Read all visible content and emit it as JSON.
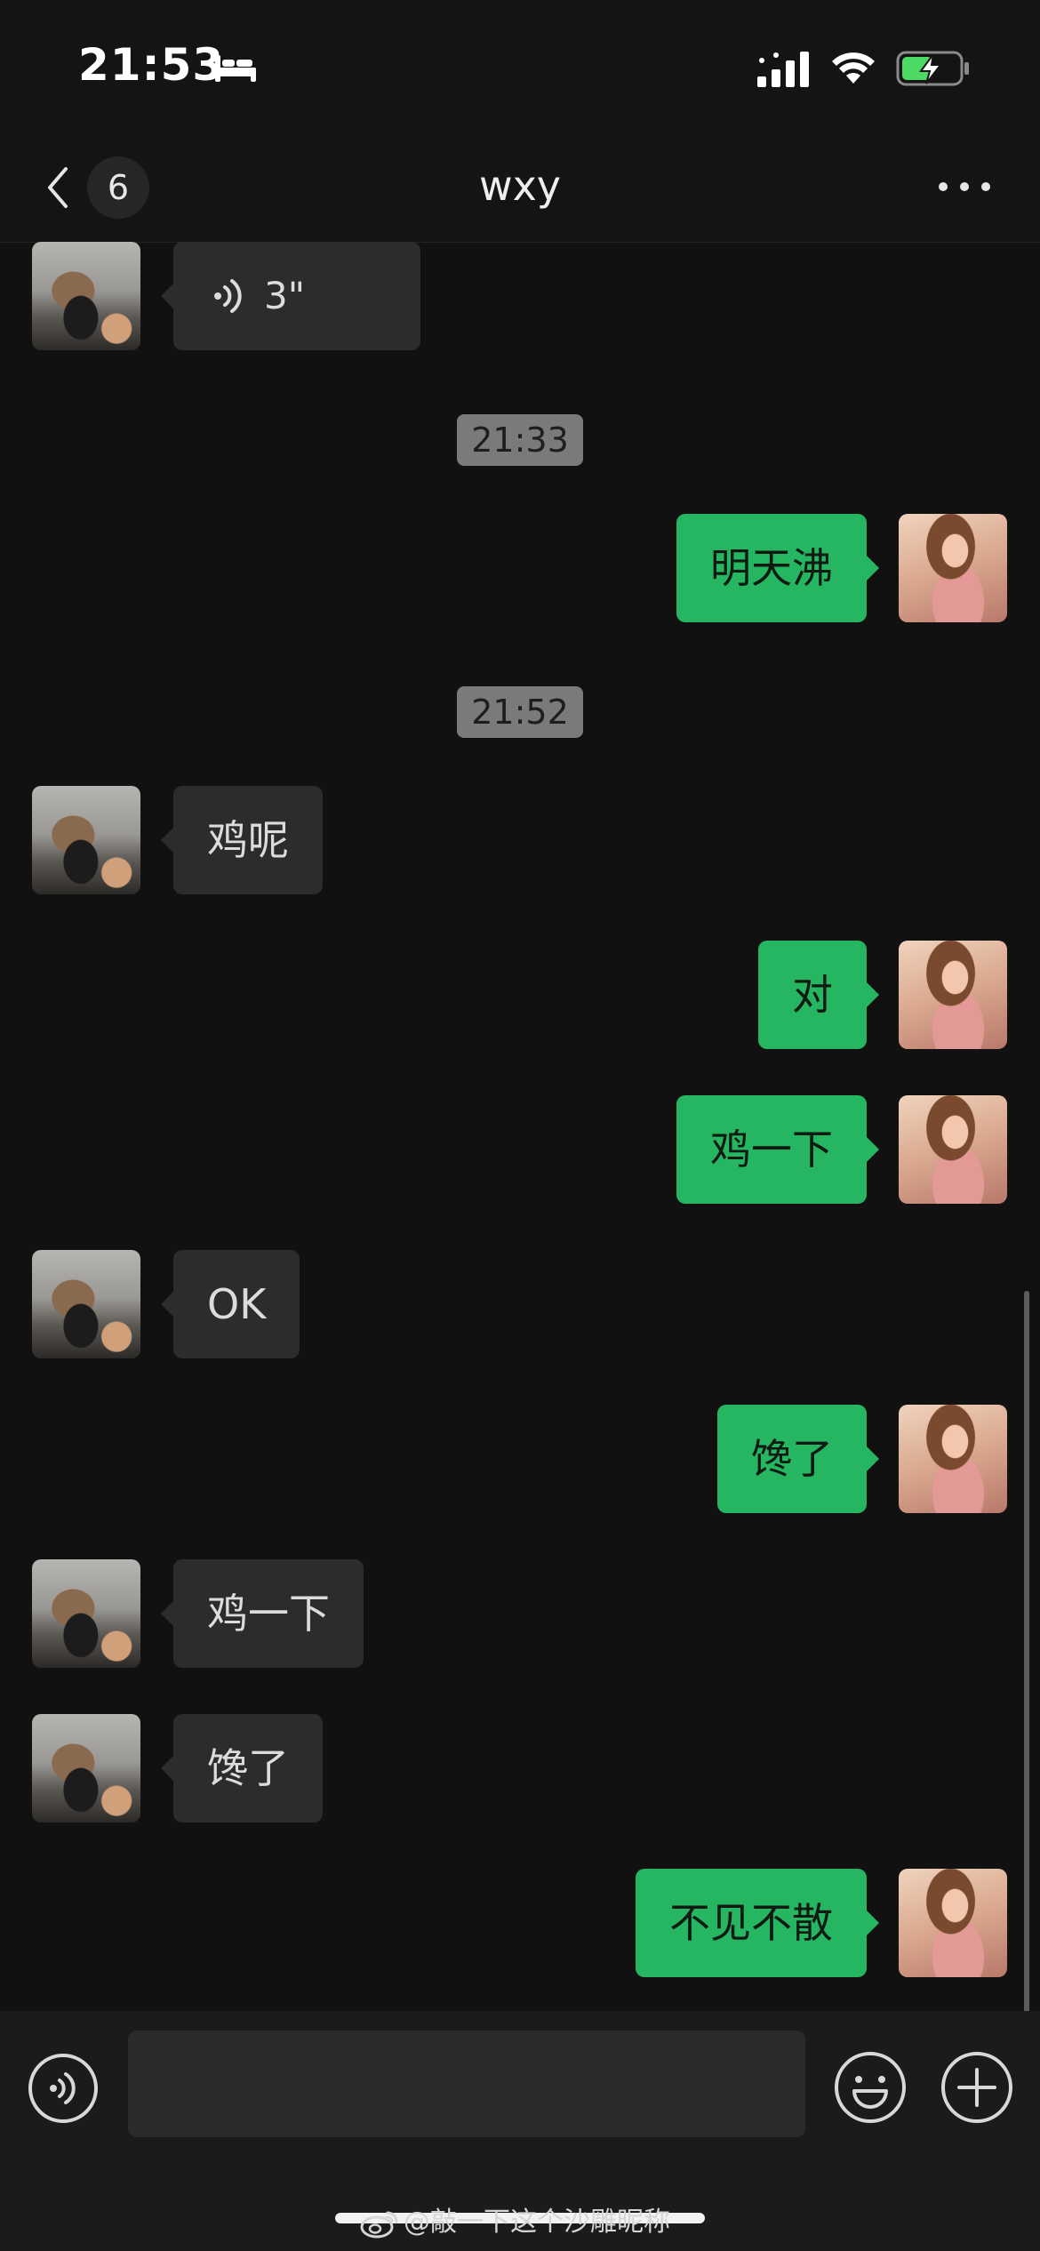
{
  "status_bar": {
    "time": "21:53",
    "icons": [
      "bed-icon",
      "signal-icon",
      "wifi-icon",
      "battery-charging-icon"
    ],
    "battery_color": "#4cd964"
  },
  "nav": {
    "unread_count": "6",
    "title": "wxy",
    "back_icon": "chevron-left-icon",
    "more_icon": "more-dots-icon"
  },
  "colors": {
    "background": "#111111",
    "bubble_them": "#2c2c2c",
    "bubble_me": "#26b561",
    "timestamp_bg": "#7a7a7a"
  },
  "messages": [
    {
      "type": "voice",
      "sender": "them",
      "duration": "3\""
    },
    {
      "type": "timestamp",
      "text": "21:33"
    },
    {
      "type": "text",
      "sender": "me",
      "text": "明天沸"
    },
    {
      "type": "timestamp",
      "text": "21:52"
    },
    {
      "type": "text",
      "sender": "them",
      "text": "鸡呢"
    },
    {
      "type": "text",
      "sender": "me",
      "text": "对"
    },
    {
      "type": "text",
      "sender": "me",
      "text": "鸡一下"
    },
    {
      "type": "text",
      "sender": "them",
      "text": "OK"
    },
    {
      "type": "text",
      "sender": "me",
      "text": "馋了"
    },
    {
      "type": "text",
      "sender": "them",
      "text": "鸡一下"
    },
    {
      "type": "text",
      "sender": "them",
      "text": "馋了"
    },
    {
      "type": "text",
      "sender": "me",
      "text": "不见不散"
    }
  ],
  "input_bar": {
    "message_value": "",
    "voice_icon": "voice-input-icon",
    "emoji_icon": "emoji-icon",
    "plus_icon": "plus-icon"
  },
  "watermark": {
    "text": "@敲一下这个沙雕昵称",
    "logo_icon": "weibo-logo-icon"
  }
}
